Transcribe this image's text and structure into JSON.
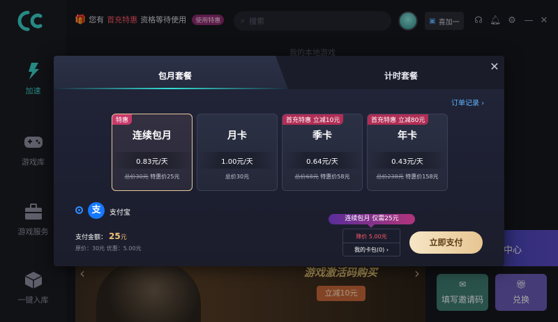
{
  "sidebar": {
    "items": [
      {
        "label": "加速",
        "icon": "bolt-icon",
        "active": true
      },
      {
        "label": "游戏库",
        "icon": "gamepad-icon",
        "active": false
      },
      {
        "label": "游戏服务",
        "icon": "briefcase-icon",
        "active": false
      },
      {
        "label": "一键入库",
        "icon": "cube-icon",
        "active": false
      }
    ]
  },
  "topbar": {
    "promo_prefix": "您有",
    "promo_highlight": "首充特惠",
    "promo_suffix": "资格等待使用",
    "promo_button": "使用特惠",
    "search_placeholder": "搜索",
    "account_button": "喜加一"
  },
  "background": {
    "local_games_label": "我的本地游戏",
    "banner_title": "游戏激活码购买",
    "banner_cta": "立减10元",
    "right_card_label": "中心",
    "invite_card_label": "填写邀请码",
    "redeem_card_label": "兑换"
  },
  "modal": {
    "tabs": [
      {
        "label": "包月套餐",
        "active": true
      },
      {
        "label": "计时套餐",
        "active": false
      }
    ],
    "order_link": "订单记录 ›",
    "plans": [
      {
        "badge": "特惠",
        "name": "连续包月",
        "per_day": "0.83元/天",
        "orig_total": "总价30元",
        "sale_total": "特惠价25元",
        "selected": true
      },
      {
        "badge": "",
        "name": "月卡",
        "per_day": "1.00元/天",
        "orig_total": "",
        "sale_total": "总价30元",
        "selected": false
      },
      {
        "badge": "首充特惠 立减10元",
        "name": "季卡",
        "per_day": "0.64元/天",
        "orig_total": "总价68元",
        "sale_total": "特惠价58元",
        "selected": false
      },
      {
        "badge": "首充特惠 立减80元",
        "name": "年卡",
        "per_day": "0.43元/天",
        "orig_total": "总价238元",
        "sale_total": "特惠价158元",
        "selected": false
      }
    ],
    "payment_method": "支付宝",
    "amount_label": "支付金额：",
    "amount_value": "25",
    "amount_unit": "元",
    "original_line": "原价：30元 优惠：5.00元",
    "tip": "连续包月 仅需25元",
    "coupon_discount": "降价 5.00元",
    "coupon_wallet": "我的卡包(0) ›",
    "pay_button": "立即支付"
  },
  "colors": {
    "accent": "#3bd3c9",
    "pay_button": "#f6e6c6",
    "alipay": "#1678ff",
    "badge": "#c83a6a"
  }
}
